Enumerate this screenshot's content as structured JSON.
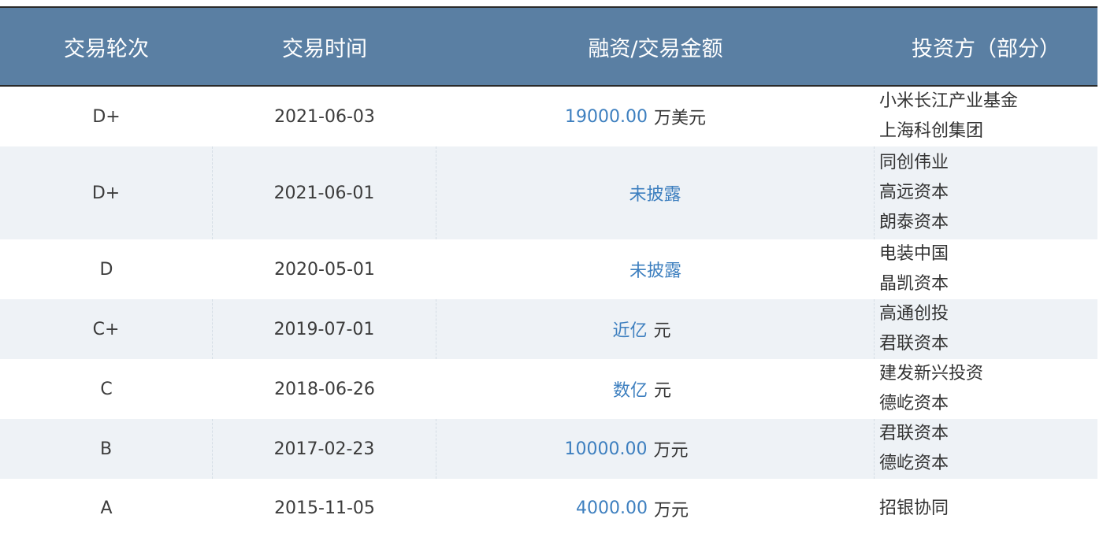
{
  "header": {
    "col_round": "交易轮次",
    "col_date": "交易时间",
    "col_amount": "融资/交易金额",
    "col_investors": "投资方（部分）"
  },
  "rows": [
    {
      "round": "D+",
      "date": "2021-06-03",
      "amount": "19000.00",
      "unit": "万美元",
      "investors": [
        "小米长江产业基金",
        "上海科创集团"
      ]
    },
    {
      "round": "D+",
      "date": "2021-06-01",
      "amount": "未披露",
      "unit": "",
      "investors": [
        "同创伟业",
        "高远资本",
        "朗泰资本"
      ]
    },
    {
      "round": "D",
      "date": "2020-05-01",
      "amount": "未披露",
      "unit": "",
      "investors": [
        "电装中国",
        "晶凯资本"
      ]
    },
    {
      "round": "C+",
      "date": "2019-07-01",
      "amount": "近亿",
      "unit": "元",
      "investors": [
        "高通创投",
        "君联资本"
      ]
    },
    {
      "round": "C",
      "date": "2018-06-26",
      "amount": "数亿",
      "unit": "元",
      "investors": [
        "建发新兴投资",
        "德屹资本"
      ]
    },
    {
      "round": "B",
      "date": "2017-02-23",
      "amount": "10000.00",
      "unit": "万元",
      "investors": [
        "君联资本",
        "德屹资本"
      ]
    },
    {
      "round": "A",
      "date": "2015-11-05",
      "amount": "4000.00",
      "unit": "万元",
      "investors": [
        "招银协同"
      ]
    }
  ],
  "colors": {
    "header_bg": "#5a7fa3",
    "amount_text": "#3d7fbf",
    "alt_row_bg": "#eef2f6"
  }
}
